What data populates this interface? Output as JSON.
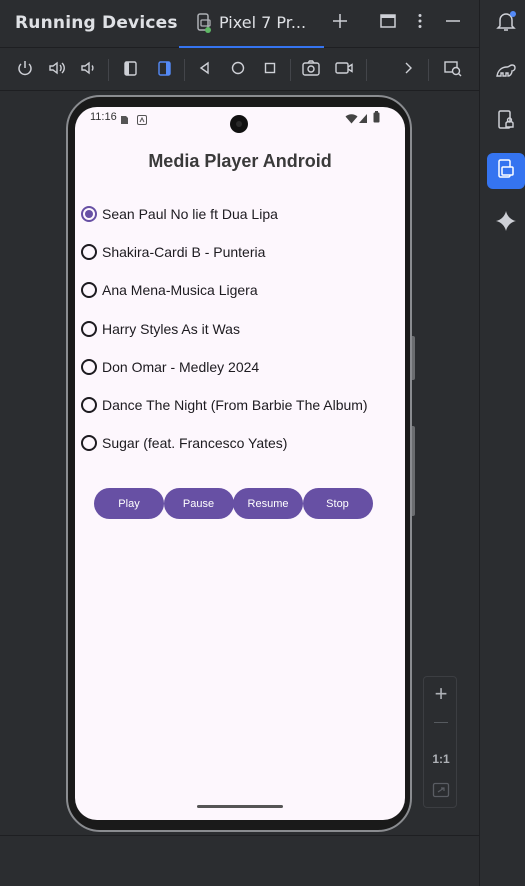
{
  "panel": {
    "title": "Running Devices",
    "device_tab_label": "Pixel 7 Pr...",
    "header_icons": [
      "phone-device-icon",
      "plus-icon",
      "window-layout-icon",
      "more-vert-icon",
      "minimize-icon"
    ]
  },
  "toolbar": {
    "icons": [
      "power-icon",
      "volume-up-icon",
      "volume-down-icon",
      "rotate-left-icon",
      "rotate-right-icon",
      "back-icon",
      "home-icon",
      "overview-icon",
      "screenshot-icon",
      "screen-record-icon",
      "chevron-right-icon",
      "device-explorer-icon"
    ]
  },
  "right_strip": {
    "icons": [
      "notifications-icon",
      "gradle-icon",
      "device-manager-icon",
      "running-devices-icon",
      "gemini-icon"
    ]
  },
  "device": {
    "status_time": "11:16",
    "app_title": "Media Player Android",
    "selected_index": 0,
    "songs": [
      "Sean Paul No lie ft Dua Lipa",
      "Shakira-Cardi B - Punteria",
      "Ana Mena-Musica Ligera",
      "Harry Styles As it Was",
      "Don Omar - Medley 2024",
      "Dance The Night (From Barbie The Album)",
      "Sugar (feat. Francesco Yates)"
    ],
    "buttons": {
      "play": "Play",
      "pause": "Pause",
      "resume": "Resume",
      "stop": "Stop"
    }
  },
  "zoom": {
    "zoom_in": "+",
    "zoom_out": "—",
    "actual_size": "1:1"
  },
  "colors": {
    "ide_bg": "#2b2d30",
    "accent": "#3574f0",
    "app_primary": "#6750a4",
    "app_bg": "#fdf7fd"
  }
}
